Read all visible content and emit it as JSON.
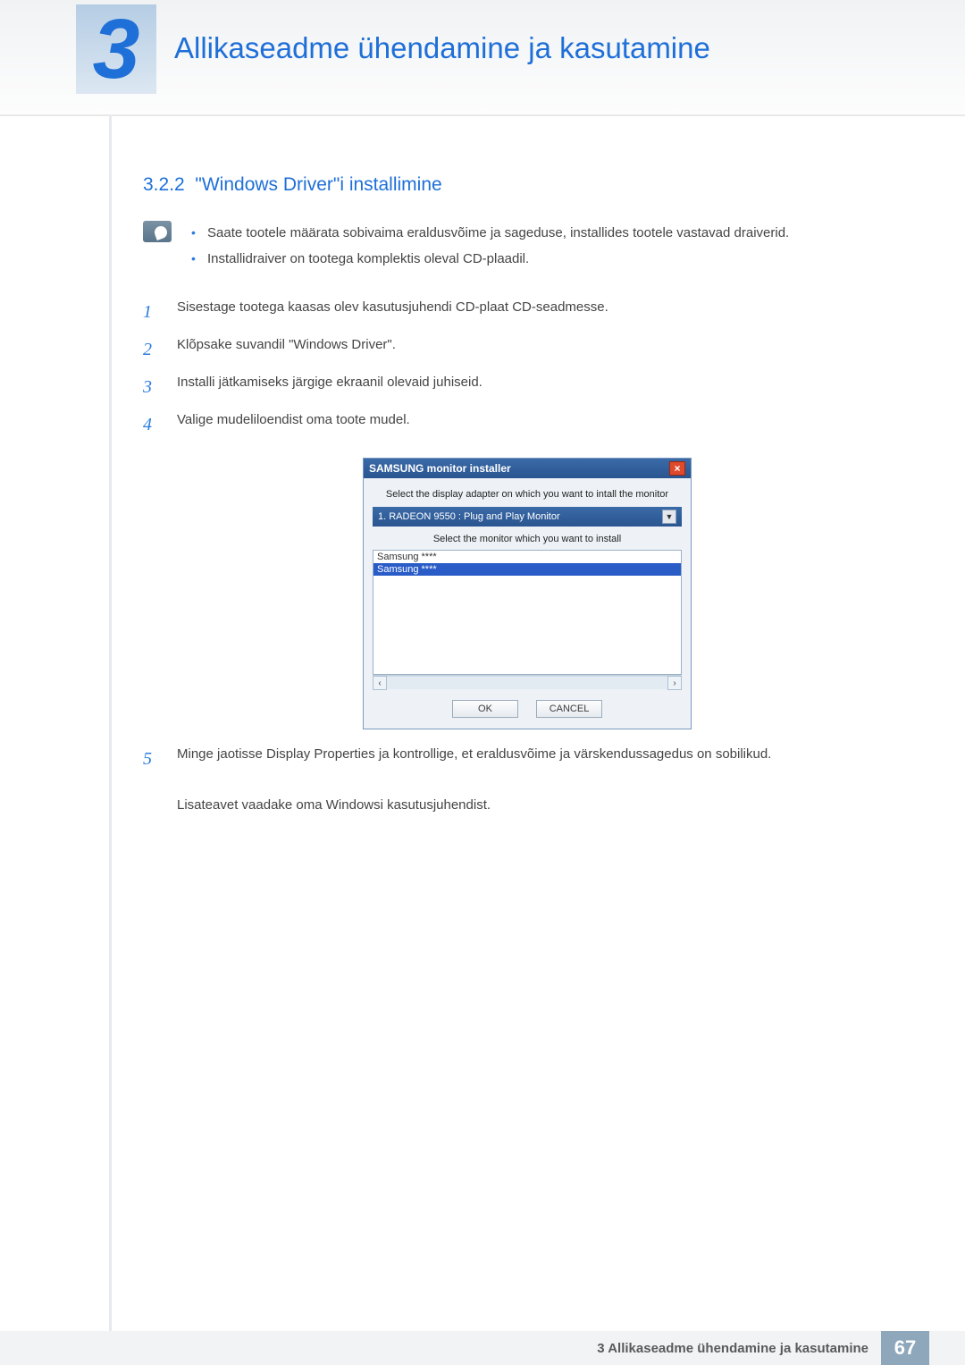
{
  "header": {
    "chapter_number": "3",
    "chapter_title": "Allikaseadme ühendamine ja kasutamine"
  },
  "section": {
    "number": "3.2.2",
    "title": "\"Windows Driver\"i installimine"
  },
  "notes": [
    "Saate tootele määrata sobivaima eraldusvõime ja sageduse, installides tootele vastavad draiverid.",
    "Installidraiver on tootega komplektis oleval CD-plaadil."
  ],
  "steps": {
    "s1": {
      "num": "1",
      "text": "Sisestage tootega kaasas olev kasutusjuhendi CD-plaat CD-seadmesse."
    },
    "s2": {
      "num": "2",
      "text": "Klõpsake suvandil \"Windows Driver\"."
    },
    "s3": {
      "num": "3",
      "text": "Installi jätkamiseks järgige ekraanil olevaid juhiseid."
    },
    "s4": {
      "num": "4",
      "text": "Valige mudeliloendist oma toote mudel."
    },
    "s5": {
      "num": "5",
      "text_a": "Minge jaotisse Display Properties ja kontrollige, et eraldusvõime ja värskendussagedus on sobilikud.",
      "text_b": "Lisateavet vaadake oma Windowsi kasutusjuhendist."
    }
  },
  "installer": {
    "title": "SAMSUNG monitor installer",
    "label_adapter": "Select the display adapter on which you want to intall the monitor",
    "adapter_value": "1. RADEON 9550 : Plug and Play Monitor",
    "label_monitor": "Select the monitor which you want to install",
    "list_item_a": "Samsung ****",
    "list_item_b": "Samsung ****",
    "btn_ok": "OK",
    "btn_cancel": "CANCEL"
  },
  "footer": {
    "text": "3 Allikaseadme ühendamine ja kasutamine",
    "page": "67"
  }
}
